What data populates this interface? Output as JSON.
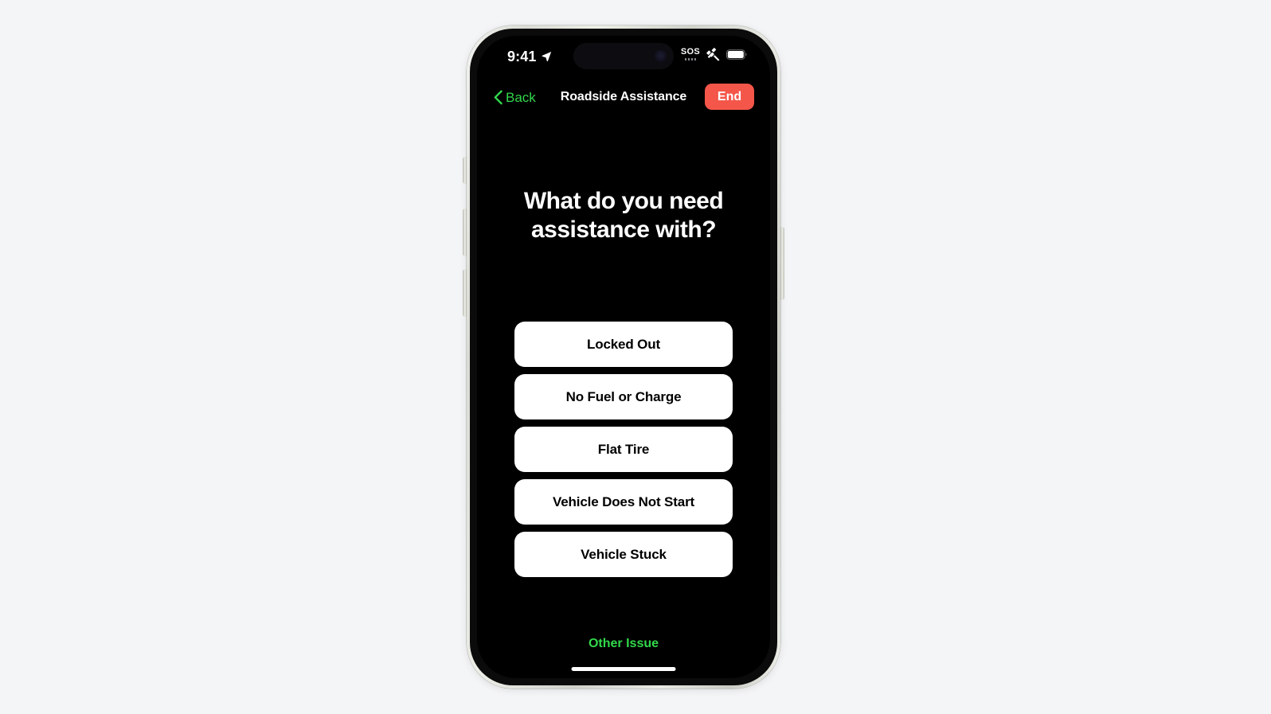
{
  "page": {
    "background_color": "#f4f5f7"
  },
  "device": {
    "frame_color": "#dfe1da",
    "screen_background": "#000000",
    "buttons": {
      "action_button": "action-button",
      "volume_up": "volume-up-button",
      "volume_down": "volume-down-button",
      "power": "power-button"
    }
  },
  "status_bar": {
    "time": "9:41",
    "location_icon": "location-arrow-icon",
    "sos_label": "SOS",
    "satellite_icon": "satellite-icon",
    "battery_icon": "battery-icon",
    "dynamic_island": "dynamic-island"
  },
  "nav_bar": {
    "back_label": "Back",
    "back_icon": "chevron-left-icon",
    "title": "Roadside Assistance",
    "end_label": "End",
    "accent_color": "#32d74b",
    "end_button_color": "#f4564a"
  },
  "main": {
    "heading": "What do you need assistance with?",
    "options": [
      {
        "label": "Locked Out"
      },
      {
        "label": "No Fuel or Charge"
      },
      {
        "label": "Flat Tire"
      },
      {
        "label": "Vehicle Does Not Start"
      },
      {
        "label": "Vehicle Stuck"
      }
    ],
    "other_issue_label": "Other Issue",
    "option_background": "#ffffff",
    "option_text_color": "#000000"
  }
}
